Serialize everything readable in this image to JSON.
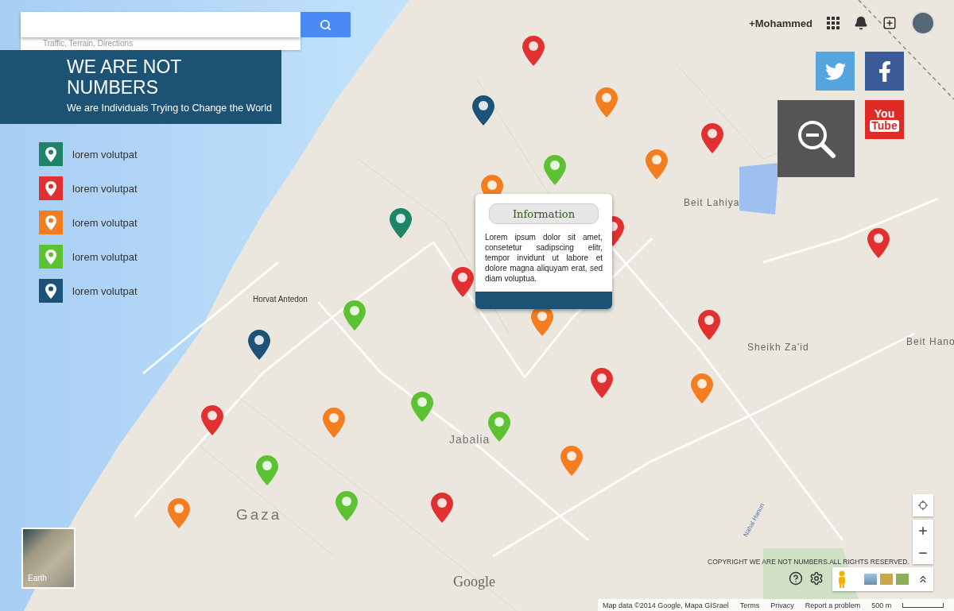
{
  "search": {
    "hint": "Traffic, Terrain, Directions"
  },
  "brand": {
    "title": "WE ARE NOT NUMBERS",
    "subtitle": "We are Individuals Trying to Change the World"
  },
  "legend": [
    {
      "label": "lorem volutpat",
      "color": "#1d8467"
    },
    {
      "label": "lorem volutpat",
      "color": "#e0302f"
    },
    {
      "label": "lorem volutpat",
      "color": "#f47d20"
    },
    {
      "label": "lorem volutpat",
      "color": "#5cc231"
    },
    {
      "label": "lorem volutpat",
      "color": "#1c5277"
    }
  ],
  "account": {
    "user": "+Mohammed"
  },
  "social": [
    {
      "kind": "twitter"
    },
    {
      "kind": "facebook"
    },
    {
      "kind": "youtube",
      "text": [
        "You",
        "Tube"
      ]
    }
  ],
  "popup": {
    "title": "Information",
    "body": "Lorem ipsum dolor sit amet, consetetur sadipscing elitr, tempor invidunt ut labore et dolore magna aliquyam erat, sed diam voluptua."
  },
  "places": [
    {
      "kind": "small",
      "label": "Beit Lahiya"
    },
    {
      "kind": "small",
      "label": "Sheikh Za'id"
    },
    {
      "kind": "small",
      "label": "Beit Hano"
    },
    {
      "kind": "poi",
      "label": "Horvat Antedon"
    },
    {
      "kind": "town",
      "label": "Jabalia"
    },
    {
      "kind": "city",
      "label": "Gaza"
    },
    {
      "kind": "river",
      "label": "Nahal Hanun"
    },
    {
      "kind": "logo",
      "label": "Google"
    }
  ],
  "pins": [
    {
      "color": "#e0302f"
    },
    {
      "color": "#1c5277"
    },
    {
      "color": "#f47d20"
    },
    {
      "color": "#e0302f"
    },
    {
      "color": "#f47d20"
    },
    {
      "color": "#5cc231"
    },
    {
      "color": "#f47d20"
    },
    {
      "color": "#1d8467"
    },
    {
      "color": "#e0302f"
    },
    {
      "color": "#e0302f"
    },
    {
      "color": "#e0302f"
    },
    {
      "color": "#5cc231"
    },
    {
      "color": "#f47d20"
    },
    {
      "color": "#1c5277"
    },
    {
      "color": "#e0302f"
    },
    {
      "color": "#e0302f"
    },
    {
      "color": "#f47d20"
    },
    {
      "color": "#5cc231"
    },
    {
      "color": "#e0302f"
    },
    {
      "color": "#f47d20"
    },
    {
      "color": "#5cc231"
    },
    {
      "color": "#f47d20"
    },
    {
      "color": "#5cc231"
    },
    {
      "color": "#5cc231"
    },
    {
      "color": "#e0302f"
    },
    {
      "color": "#f47d20"
    }
  ],
  "earth": {
    "label": "Earth"
  },
  "copyright": "COPYRIGHT WE ARE NOT NUMBERS.ALL RIGHTS RESERVED.",
  "footer": {
    "attribution": "Map data ©2014 Google, Mapa GISrael",
    "links": [
      "Terms",
      "Privacy",
      "Report a problem"
    ],
    "scale": "500 m"
  }
}
